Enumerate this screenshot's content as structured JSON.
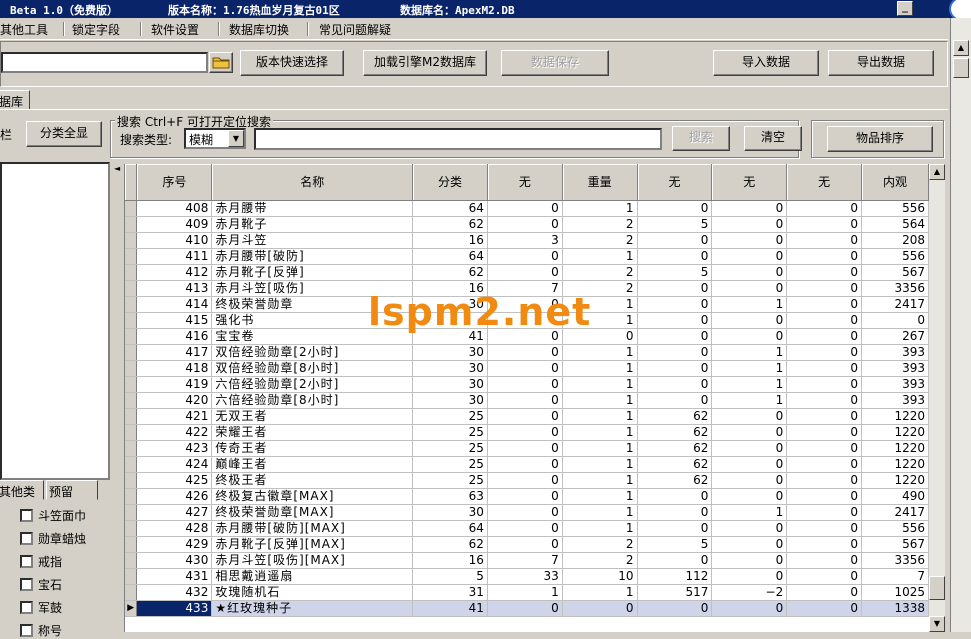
{
  "titlebar": {
    "version": "Beta 1.0（免费版）",
    "edition": "版本名称：1.76热血岁月复古01区",
    "database": "数据库名：ApexM2.DB",
    "minimize_glyph": "_"
  },
  "menu": [
    "其他工具",
    "锁定字段",
    "软件设置",
    "数据库切换",
    "常见问题解疑"
  ],
  "toolbar": {
    "path_value": "",
    "folder_icon": "folder-icon",
    "version_select": "版本快速选择",
    "load_db": "加载引擎M2数据库",
    "save_data": "数据保存",
    "import_data": "导入数据",
    "export_data": "导出数据"
  },
  "tabs": {
    "db_tab": "据库"
  },
  "search": {
    "left_title": "栏",
    "show_all": "分类全显",
    "group_title": "搜索   Ctrl+F 可打开定位搜索",
    "type_label": "搜索类型:",
    "type_value": "模糊",
    "query": "",
    "search_btn": "搜索",
    "clear_btn": "清空",
    "sort_btn": "物品排序"
  },
  "left_panel": {
    "tabs": [
      "其他类",
      "预留"
    ],
    "checkboxes": [
      "斗笠面巾",
      "勋章蜡烛",
      "戒指",
      "宝石",
      "军鼓",
      "称号"
    ]
  },
  "grid": {
    "columns": [
      "序号",
      "名称",
      "分类",
      "无",
      "重量",
      "无",
      "无",
      "无",
      "内观"
    ],
    "rows": [
      [
        "408",
        "赤月腰带",
        "64",
        "0",
        "1",
        "0",
        "0",
        "0",
        "556"
      ],
      [
        "409",
        "赤月靴子",
        "62",
        "0",
        "2",
        "5",
        "0",
        "0",
        "564"
      ],
      [
        "410",
        "赤月斗笠",
        "16",
        "3",
        "2",
        "0",
        "0",
        "0",
        "208"
      ],
      [
        "411",
        "赤月腰带[破防]",
        "64",
        "0",
        "1",
        "0",
        "0",
        "0",
        "556"
      ],
      [
        "412",
        "赤月靴子[反弹]",
        "62",
        "0",
        "2",
        "5",
        "0",
        "0",
        "567"
      ],
      [
        "413",
        "赤月斗笠[吸伤]",
        "16",
        "7",
        "2",
        "0",
        "0",
        "0",
        "3356"
      ],
      [
        "414",
        "终极荣誉勋章",
        "30",
        "0",
        "1",
        "0",
        "1",
        "0",
        "2417"
      ],
      [
        "415",
        "强化书",
        "",
        "",
        "1",
        "0",
        "0",
        "0",
        "0"
      ],
      [
        "416",
        "宝宝卷",
        "41",
        "0",
        "0",
        "0",
        "0",
        "0",
        "267"
      ],
      [
        "417",
        "双倍经验勋章[2小时]",
        "30",
        "0",
        "1",
        "0",
        "1",
        "0",
        "393"
      ],
      [
        "418",
        "双倍经验勋章[8小时]",
        "30",
        "0",
        "1",
        "0",
        "1",
        "0",
        "393"
      ],
      [
        "419",
        "六倍经验勋章[2小时]",
        "30",
        "0",
        "1",
        "0",
        "1",
        "0",
        "393"
      ],
      [
        "420",
        "六倍经验勋章[8小时]",
        "30",
        "0",
        "1",
        "0",
        "1",
        "0",
        "393"
      ],
      [
        "421",
        "无双王者",
        "25",
        "0",
        "1",
        "62",
        "0",
        "0",
        "1220"
      ],
      [
        "422",
        "荣耀王者",
        "25",
        "0",
        "1",
        "62",
        "0",
        "0",
        "1220"
      ],
      [
        "423",
        "传奇王者",
        "25",
        "0",
        "1",
        "62",
        "0",
        "0",
        "1220"
      ],
      [
        "424",
        "巅峰王者",
        "25",
        "0",
        "1",
        "62",
        "0",
        "0",
        "1220"
      ],
      [
        "425",
        "终极王者",
        "25",
        "0",
        "1",
        "62",
        "0",
        "0",
        "1220"
      ],
      [
        "426",
        "终极复古徽章[MAX]",
        "63",
        "0",
        "1",
        "0",
        "0",
        "0",
        "490"
      ],
      [
        "427",
        "终极荣誉勋章[MAX]",
        "30",
        "0",
        "1",
        "0",
        "1",
        "0",
        "2417"
      ],
      [
        "428",
        "赤月腰带[破防][MAX]",
        "64",
        "0",
        "1",
        "0",
        "0",
        "0",
        "556"
      ],
      [
        "429",
        "赤月靴子[反弹][MAX]",
        "62",
        "0",
        "2",
        "5",
        "0",
        "0",
        "567"
      ],
      [
        "430",
        "赤月斗笠[吸伤][MAX]",
        "16",
        "7",
        "2",
        "0",
        "0",
        "0",
        "3356"
      ],
      [
        "431",
        "相思戴逍遥扇",
        "5",
        "33",
        "10",
        "112",
        "0",
        "0",
        "7"
      ],
      [
        "432",
        "玫瑰随机石",
        "31",
        "1",
        "1",
        "517",
        "−2",
        "0",
        "1025"
      ],
      [
        "433",
        "★红玫瑰种子",
        "41",
        "0",
        "0",
        "0",
        "0",
        "0",
        "1338"
      ]
    ],
    "selected_row": "433",
    "row_pointer": "▶"
  },
  "watermark": "lspm2.net",
  "colors": {
    "title_bg": "#0a246a",
    "selection": "#0a246a",
    "watermark": "#f08a10"
  }
}
